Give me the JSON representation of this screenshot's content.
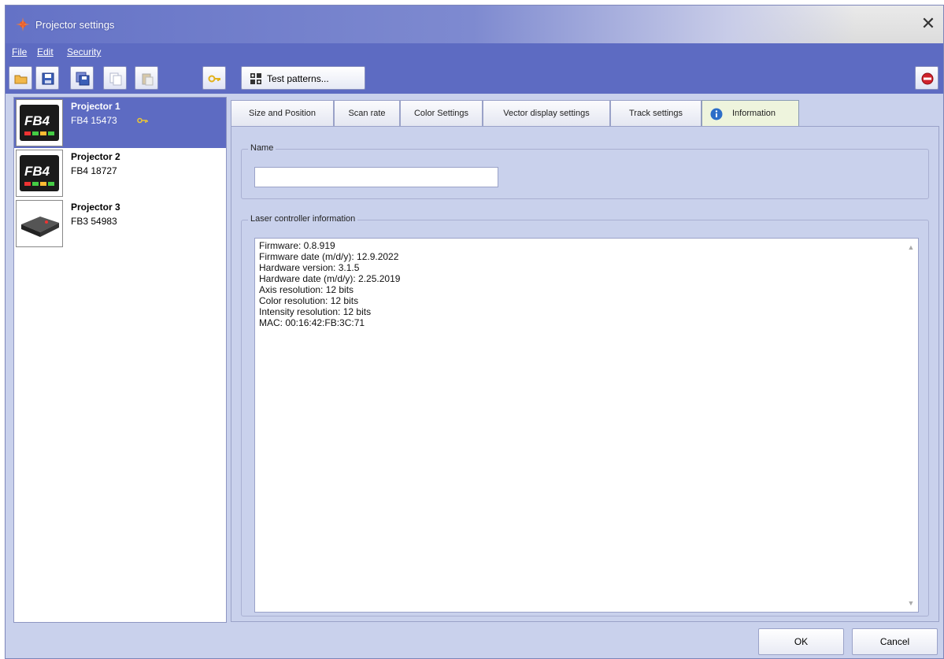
{
  "window": {
    "title": "Projector settings"
  },
  "menu": {
    "items": [
      "File",
      "Edit",
      "Security"
    ]
  },
  "toolbar": {
    "buttons": [
      "open-icon",
      "save-icon",
      "save-as-icon",
      "copy-icon",
      "paste-icon",
      "key-icon"
    ],
    "test_patterns_label": "Test patterns...",
    "stop_icon": "stop-icon"
  },
  "projectors": [
    {
      "name": "Projector 1",
      "serial": "FB4 15473",
      "badge": "FB4",
      "selected": true,
      "has_key": true
    },
    {
      "name": "Projector 2",
      "serial": "FB4 18727",
      "badge": "FB4",
      "selected": false,
      "has_key": false
    },
    {
      "name": "Projector 3",
      "serial": "FB3 54983",
      "badge": "",
      "selected": false,
      "has_key": false
    }
  ],
  "tabs": [
    {
      "label": "Size and Position"
    },
    {
      "label": "Scan rate"
    },
    {
      "label": "Color Settings"
    },
    {
      "label": "Vector display settings"
    },
    {
      "label": "Track settings"
    },
    {
      "label": "Information",
      "active": true
    }
  ],
  "name_group": {
    "title": "Name",
    "value": ""
  },
  "info_group": {
    "title": "Laser controller information",
    "lines": [
      "Firmware: 0.8.919",
      "Firmware date (m/d/y): 12.9.2022",
      "Hardware version: 3.1.5",
      "Hardware date (m/d/y): 2.25.2019",
      "Axis resolution: 12 bits",
      "Color resolution: 12 bits",
      "Intensity resolution: 12 bits",
      "MAC: 00:16:42:FB:3C:71"
    ]
  },
  "buttons": {
    "ok": "OK",
    "cancel": "Cancel"
  },
  "colors": {
    "accent": "#5d6bc2",
    "panel_bg": "#c9d1ec",
    "active_tab_bg": "#eef4dd"
  }
}
